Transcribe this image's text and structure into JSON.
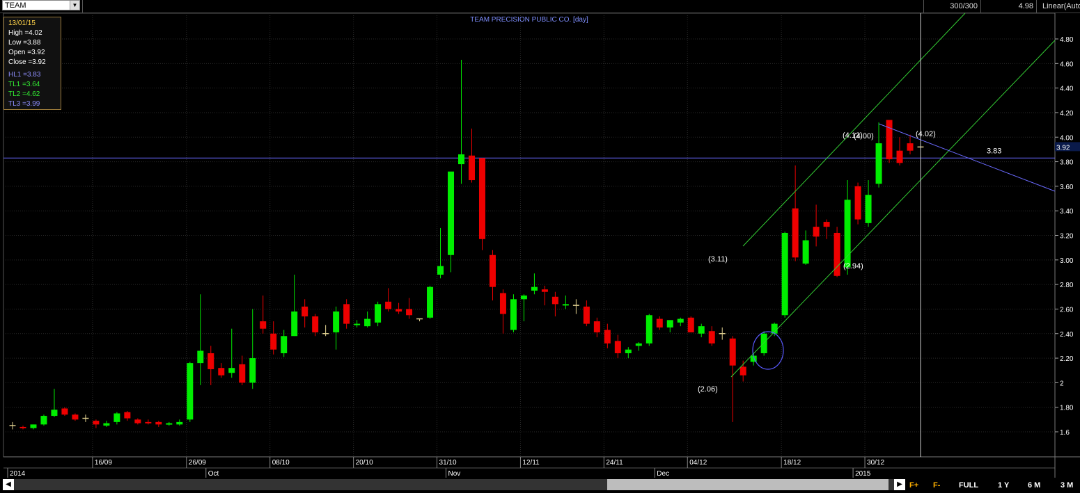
{
  "toolbar": {
    "symbol": "TEAM",
    "counter": "300/300",
    "last_price": "4.98",
    "scale_mode": "Linear(Auto"
  },
  "infobox": {
    "date": "13/01/15",
    "high": "High  =4.02",
    "low": "Low   =3.88",
    "open": "Open  =3.92",
    "close": "Close  =3.92",
    "hl1": "HL1 =3.83",
    "tl1": "TL1 =3.64",
    "tl2": "TL2 =4.62",
    "tl3": "TL3 =3.99"
  },
  "bottom_buttons": {
    "f_plus": "F+",
    "f_minus": "F-",
    "full": "FULL",
    "one_year": "1 Y",
    "six_month": "6 M",
    "three_month": "3 M"
  },
  "colors": {
    "up": "#00ee00",
    "down": "#ee0000",
    "grid": "#2a2a2a",
    "hline": "#6a6aff",
    "channel": "#33cc33"
  },
  "chart_data": {
    "type": "candlestick",
    "title": "TEAM PRECISION PUBLIC CO. [day]",
    "ylim": [
      1.3,
      4.98
    ],
    "y_ticks": [
      "1.6",
      "1.80",
      "2",
      "2.20",
      "2.40",
      "2.60",
      "2.80",
      "3.00",
      "3.20",
      "3.40",
      "3.60",
      "3.80",
      "4.00",
      "4.20",
      "4.40",
      "4.60",
      "4.80"
    ],
    "x_ticks_top": [
      "16/09",
      "26/09",
      "08/10",
      "20/10",
      "31/10",
      "12/11",
      "24/11",
      "04/12",
      "18/12",
      "30/12"
    ],
    "x_ticks_bottom": [
      "2014",
      "Oct",
      "Nov",
      "Dec",
      "2015"
    ],
    "current_price_label": "3.92",
    "hline": {
      "value": 3.83,
      "label": "3.83"
    },
    "annotations": [
      "(3.11)",
      "(2.06)",
      "(2.94)",
      "(4.12)",
      "(4.00)",
      "(4.02)"
    ],
    "candles": [
      {
        "o": 1.65,
        "h": 1.68,
        "l": 1.62,
        "c": 1.65
      },
      {
        "o": 1.64,
        "h": 1.65,
        "l": 1.62,
        "c": 1.63
      },
      {
        "o": 1.63,
        "h": 1.66,
        "l": 1.62,
        "c": 1.66
      },
      {
        "o": 1.66,
        "h": 1.74,
        "l": 1.65,
        "c": 1.73
      },
      {
        "o": 1.73,
        "h": 1.95,
        "l": 1.72,
        "c": 1.78
      },
      {
        "o": 1.79,
        "h": 1.8,
        "l": 1.73,
        "c": 1.74
      },
      {
        "o": 1.74,
        "h": 1.75,
        "l": 1.69,
        "c": 1.7
      },
      {
        "o": 1.71,
        "h": 1.74,
        "l": 1.68,
        "c": 1.71
      },
      {
        "o": 1.69,
        "h": 1.7,
        "l": 1.63,
        "c": 1.66
      },
      {
        "o": 1.65,
        "h": 1.69,
        "l": 1.64,
        "c": 1.67
      },
      {
        "o": 1.68,
        "h": 1.76,
        "l": 1.66,
        "c": 1.75
      },
      {
        "o": 1.76,
        "h": 1.77,
        "l": 1.69,
        "c": 1.71
      },
      {
        "o": 1.7,
        "h": 1.71,
        "l": 1.66,
        "c": 1.67
      },
      {
        "o": 1.68,
        "h": 1.7,
        "l": 1.66,
        "c": 1.67
      },
      {
        "o": 1.68,
        "h": 1.69,
        "l": 1.64,
        "c": 1.66
      },
      {
        "o": 1.66,
        "h": 1.68,
        "l": 1.65,
        "c": 1.67
      },
      {
        "o": 1.66,
        "h": 1.7,
        "l": 1.65,
        "c": 1.68
      },
      {
        "o": 1.7,
        "h": 2.17,
        "l": 1.68,
        "c": 2.16
      },
      {
        "o": 2.16,
        "h": 2.72,
        "l": 1.98,
        "c": 2.26
      },
      {
        "o": 2.24,
        "h": 2.3,
        "l": 1.98,
        "c": 2.11
      },
      {
        "o": 2.12,
        "h": 2.16,
        "l": 2.04,
        "c": 2.06
      },
      {
        "o": 2.08,
        "h": 2.44,
        "l": 2.04,
        "c": 2.12
      },
      {
        "o": 2.15,
        "h": 2.22,
        "l": 1.98,
        "c": 2.0
      },
      {
        "o": 2.0,
        "h": 2.6,
        "l": 1.95,
        "c": 2.2
      },
      {
        "o": 2.5,
        "h": 2.71,
        "l": 2.4,
        "c": 2.44
      },
      {
        "o": 2.4,
        "h": 2.5,
        "l": 2.23,
        "c": 2.27
      },
      {
        "o": 2.24,
        "h": 2.43,
        "l": 2.21,
        "c": 2.38
      },
      {
        "o": 2.38,
        "h": 2.88,
        "l": 2.38,
        "c": 2.58
      },
      {
        "o": 2.62,
        "h": 2.68,
        "l": 2.45,
        "c": 2.54
      },
      {
        "o": 2.54,
        "h": 2.56,
        "l": 2.38,
        "c": 2.41
      },
      {
        "o": 2.4,
        "h": 2.47,
        "l": 2.38,
        "c": 2.4
      },
      {
        "o": 2.41,
        "h": 2.62,
        "l": 2.27,
        "c": 2.58
      },
      {
        "o": 2.64,
        "h": 2.68,
        "l": 2.44,
        "c": 2.48
      },
      {
        "o": 2.47,
        "h": 2.51,
        "l": 2.45,
        "c": 2.48
      },
      {
        "o": 2.46,
        "h": 2.58,
        "l": 2.45,
        "c": 2.52
      },
      {
        "o": 2.49,
        "h": 2.66,
        "l": 2.46,
        "c": 2.64
      },
      {
        "o": 2.66,
        "h": 2.77,
        "l": 2.58,
        "c": 2.6
      },
      {
        "o": 2.6,
        "h": 2.65,
        "l": 2.56,
        "c": 2.58
      },
      {
        "o": 2.6,
        "h": 2.69,
        "l": 2.52,
        "c": 2.55
      },
      {
        "o": 2.52,
        "h": 2.52,
        "l": 2.5,
        "c": 2.52
      },
      {
        "o": 2.53,
        "h": 2.79,
        "l": 2.52,
        "c": 2.78
      },
      {
        "o": 2.88,
        "h": 3.26,
        "l": 2.85,
        "c": 2.95
      },
      {
        "o": 3.04,
        "h": 3.43,
        "l": 2.9,
        "c": 3.72
      },
      {
        "o": 3.78,
        "h": 4.63,
        "l": 3.62,
        "c": 3.86
      },
      {
        "o": 3.85,
        "h": 4.07,
        "l": 3.63,
        "c": 3.65
      },
      {
        "o": 3.83,
        "h": 3.83,
        "l": 3.08,
        "c": 3.17
      },
      {
        "o": 3.04,
        "h": 3.08,
        "l": 2.67,
        "c": 2.78
      },
      {
        "o": 2.73,
        "h": 2.76,
        "l": 2.4,
        "c": 2.56
      },
      {
        "o": 2.43,
        "h": 2.72,
        "l": 2.41,
        "c": 2.68
      },
      {
        "o": 2.68,
        "h": 2.72,
        "l": 2.5,
        "c": 2.71
      },
      {
        "o": 2.75,
        "h": 2.89,
        "l": 2.72,
        "c": 2.78
      },
      {
        "o": 2.76,
        "h": 2.79,
        "l": 2.63,
        "c": 2.74
      },
      {
        "o": 2.7,
        "h": 2.74,
        "l": 2.54,
        "c": 2.64
      },
      {
        "o": 2.63,
        "h": 2.71,
        "l": 2.6,
        "c": 2.64
      },
      {
        "o": 2.63,
        "h": 2.68,
        "l": 2.56,
        "c": 2.63
      },
      {
        "o": 2.62,
        "h": 2.67,
        "l": 2.46,
        "c": 2.48
      },
      {
        "o": 2.5,
        "h": 2.53,
        "l": 2.37,
        "c": 2.41
      },
      {
        "o": 2.43,
        "h": 2.48,
        "l": 2.28,
        "c": 2.32
      },
      {
        "o": 2.34,
        "h": 2.39,
        "l": 2.2,
        "c": 2.24
      },
      {
        "o": 2.24,
        "h": 2.29,
        "l": 2.2,
        "c": 2.27
      },
      {
        "o": 2.3,
        "h": 2.33,
        "l": 2.26,
        "c": 2.32
      },
      {
        "o": 2.32,
        "h": 2.56,
        "l": 2.3,
        "c": 2.55
      },
      {
        "o": 2.52,
        "h": 2.54,
        "l": 2.43,
        "c": 2.45
      },
      {
        "o": 2.45,
        "h": 2.51,
        "l": 2.41,
        "c": 2.51
      },
      {
        "o": 2.49,
        "h": 2.53,
        "l": 2.46,
        "c": 2.52
      },
      {
        "o": 2.53,
        "h": 2.54,
        "l": 2.42,
        "c": 2.41
      },
      {
        "o": 2.4,
        "h": 2.48,
        "l": 2.37,
        "c": 2.46
      },
      {
        "o": 2.42,
        "h": 2.46,
        "l": 2.3,
        "c": 2.32
      },
      {
        "o": 2.4,
        "h": 2.45,
        "l": 2.35,
        "c": 2.4
      },
      {
        "o": 2.36,
        "h": 2.38,
        "l": 1.68,
        "c": 2.14
      },
      {
        "o": 2.13,
        "h": 2.18,
        "l": 2.01,
        "c": 2.06
      },
      {
        "o": 2.17,
        "h": 2.24,
        "l": 2.14,
        "c": 2.22
      },
      {
        "o": 2.24,
        "h": 2.42,
        "l": 2.22,
        "c": 2.4
      },
      {
        "o": 2.4,
        "h": 2.49,
        "l": 2.38,
        "c": 2.48
      },
      {
        "o": 2.55,
        "h": 3.23,
        "l": 2.53,
        "c": 3.22
      },
      {
        "o": 3.42,
        "h": 3.77,
        "l": 2.99,
        "c": 3.02
      },
      {
        "o": 2.97,
        "h": 3.24,
        "l": 2.96,
        "c": 3.16
      },
      {
        "o": 3.27,
        "h": 3.45,
        "l": 3.11,
        "c": 3.19
      },
      {
        "o": 3.31,
        "h": 3.33,
        "l": 3.17,
        "c": 3.27
      },
      {
        "o": 3.22,
        "h": 3.27,
        "l": 2.86,
        "c": 2.87
      },
      {
        "o": 2.94,
        "h": 3.65,
        "l": 2.88,
        "c": 3.49
      },
      {
        "o": 3.6,
        "h": 3.63,
        "l": 3.29,
        "c": 3.33
      },
      {
        "o": 3.3,
        "h": 3.65,
        "l": 3.27,
        "c": 3.53
      },
      {
        "o": 3.62,
        "h": 4.12,
        "l": 3.59,
        "c": 3.95
      },
      {
        "o": 4.14,
        "h": 4.14,
        "l": 3.79,
        "c": 3.82
      },
      {
        "o": 3.89,
        "h": 4.0,
        "l": 3.77,
        "c": 3.79
      },
      {
        "o": 3.95,
        "h": 4.02,
        "l": 3.86,
        "c": 3.89
      },
      {
        "o": 3.92,
        "h": 3.98,
        "l": 3.88,
        "c": 3.92
      }
    ]
  }
}
